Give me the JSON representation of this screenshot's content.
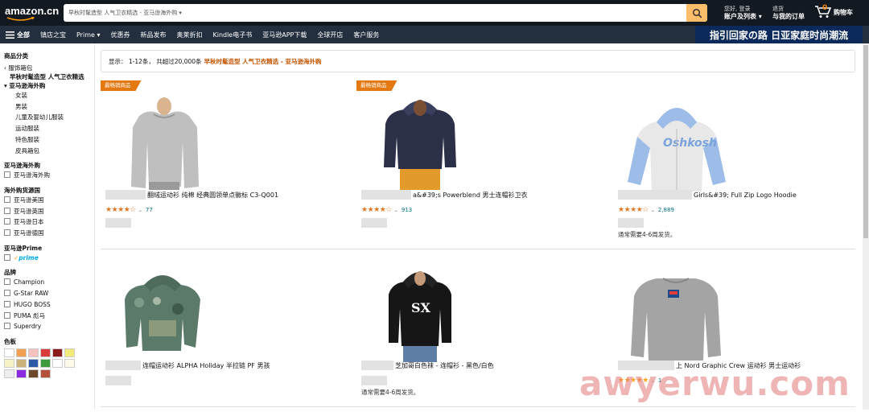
{
  "header": {
    "logo_text": "amazon.cn",
    "search_scope": "早秋时髦造型 人气卫衣精选 - 亚马逊海外购 ▾",
    "search_value": "",
    "account_line1": "您好, 登录",
    "account_line2": "账户及列表 ▾",
    "orders_line1": "退货",
    "orders_line2": "与我的订单",
    "cart_count": "0",
    "cart_label": "购物车"
  },
  "subnav": {
    "all_label": "全部",
    "items": [
      "镇店之宝",
      "Prime ▾",
      "优惠券",
      "新品发布",
      "奥莱折扣",
      "Kindle电子书",
      "亚马逊APP下载",
      "全球开店",
      "客户服务"
    ],
    "promo_text": "指引回家の路 日亚家庭时尚潮流"
  },
  "sidebar": {
    "category_heading": "商品分类",
    "back_link": "‹ 服饰箱包",
    "current_category": "早秋时髦造型 人气卫衣精选",
    "sub_heading": "▾ 亚马逊海外购",
    "subcategories": [
      "女装",
      "男装",
      "儿童及婴幼儿服装",
      "运动服装",
      "特色服装",
      "皮具箱包"
    ],
    "haiwai_heading": "亚马逊海外购",
    "haiwai_option": "亚马逊海外购",
    "source_heading": "海外购货源国",
    "sources": [
      "亚马逊美国",
      "亚马逊英国",
      "亚马逊日本",
      "亚马逊德国"
    ],
    "prime_heading": "亚马逊Prime",
    "prime_label": "prime",
    "brand_heading": "品牌",
    "brands": [
      "Champion",
      "G-Star RAW",
      "HUGO BOSS",
      "PUMA 彪马",
      "Superdry"
    ],
    "color_heading": "色板",
    "swatch_colors": [
      "#ffffff",
      "#f0a050",
      "#f4c3c0",
      "#d93b3b",
      "#8b1a1a",
      "#f2ea7a",
      "#f7f2c4",
      "#c9b37b",
      "#2a5aa8",
      "#3d9a3d",
      "#ffffff",
      "#fdfbe8",
      "#eeeeee",
      "#8a2be2",
      "#6b4a2a",
      "#b3513b"
    ]
  },
  "results": {
    "prefix": "显示： 1-12条， 共超过20,000条",
    "query": "早秋时髦造型 人气卫衣精选 - 亚马逊海外购"
  },
  "products": [
    {
      "badge": "最畅销商品",
      "title": "翻绒运动衫 纯棉 经典圆领单点徽标 C3-Q001",
      "stars": "★★★★☆",
      "rating_count": "77",
      "shipping": ""
    },
    {
      "badge": "最畅销商品",
      "title": "a&#39;s Powerblend 男士连帽衫卫衣",
      "stars": "★★★★☆",
      "rating_count": "913",
      "shipping": ""
    },
    {
      "badge": "",
      "title": "Girls&#39; Full Zip Logo Hoodie",
      "stars": "★★★★☆",
      "rating_count": "2,889",
      "shipping": "通常需要4-6周发货。"
    },
    {
      "badge": "",
      "title": "连帽运动衫 ALPHA Holiday 半拉链 PF 男孩",
      "stars": "",
      "rating_count": "",
      "shipping": ""
    },
    {
      "badge": "",
      "title": "芝加哥白色袜 - 连帽衫 - 黑色/白色",
      "stars": "",
      "rating_count": "",
      "shipping": "通常需要4-6周发货。"
    },
    {
      "badge": "",
      "title": "上 Nord Graphic Crew 运动衫 男士运动衫",
      "stars": "★★★★★",
      "rating_count": "1",
      "shipping": ""
    }
  ],
  "watermark": "awyerwu.com"
}
